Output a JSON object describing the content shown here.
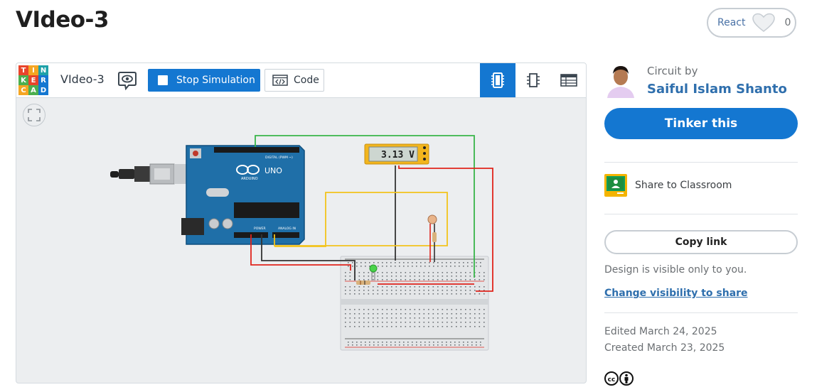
{
  "page": {
    "title": "VIdeo-3"
  },
  "react": {
    "label": "React",
    "count": "0"
  },
  "logo": {
    "letters": [
      "T",
      "I",
      "N",
      "K",
      "E",
      "R",
      "C",
      "A",
      "D"
    ],
    "colors": [
      "#e8452b",
      "#f5a623",
      "#1da1a8",
      "#4caf50",
      "#e8452b",
      "#1477d1",
      "#f5a623",
      "#4caf50",
      "#1477d1"
    ]
  },
  "toolbar": {
    "circuit_name": "VIdeo-3",
    "stop_label": "Stop Simulation",
    "code_label": "Code"
  },
  "canvas": {
    "multimeter_reading": "3.13 V",
    "arduino_brand": "UNO",
    "arduino_sub": "ARDUINO",
    "digital_label": "DIGITAL (PWM ~)",
    "power_label": "POWER",
    "analog_label": "ANALOG IN"
  },
  "sidebar": {
    "circuit_by": "Circuit by",
    "author": "Saiful Islam Shanto",
    "tinker_label": "Tinker this",
    "share_classroom": "Share to Classroom",
    "copy_link": "Copy link",
    "visibility_note": "Design is visible only to you.",
    "visibility_link": "Change visibility to share",
    "edited": "Edited March 24, 2025",
    "created": "Created March 23, 2025"
  },
  "colors": {
    "accent": "#1477d1",
    "link": "#2f6fad",
    "wire_green": "#39b54a",
    "wire_red": "#e0241c",
    "wire_yellow": "#f2c31b",
    "wire_black": "#333333"
  },
  "icons": [
    "heart-icon",
    "eye-icon",
    "stop-icon",
    "code-icon",
    "circuit-view-icon",
    "schematic-view-icon",
    "component-list-icon",
    "fit-view-icon",
    "google-classroom-icon",
    "creative-commons-icon",
    "attribution-icon"
  ]
}
